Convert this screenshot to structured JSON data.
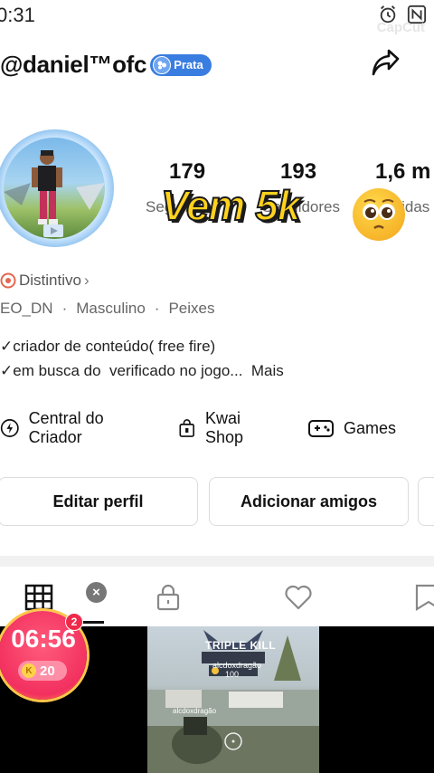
{
  "status_bar": {
    "time": "0:31",
    "watermark": "CapCut"
  },
  "profile": {
    "username": "@daniel™ofc",
    "badge_label": "Prata",
    "stats": [
      {
        "value": "179",
        "label": "Seguindo"
      },
      {
        "value": "193",
        "label": "Seguidores"
      },
      {
        "value": "1,6 m",
        "label": "Curtidas"
      }
    ],
    "promo_text": "Vem 5k",
    "distintivo_label": "Distintivo",
    "meta": [
      "EO_DN",
      "Masculino",
      "Peixes"
    ],
    "bio_lines": [
      "✓criador de conteúdo( free fire)",
      "✓em busca do  verificado no jogo...  Mais"
    ]
  },
  "quick_links": [
    {
      "icon": "lightning-icon",
      "label": "Central do Criador"
    },
    {
      "icon": "shopping-bag-icon",
      "label": "Kwai Shop"
    },
    {
      "icon": "gamepad-icon",
      "label": "Games"
    }
  ],
  "buttons": {
    "edit_profile": "Editar perfil",
    "add_friends": "Adicionar amigos"
  },
  "tabs": [
    {
      "icon": "grid-icon",
      "active": true
    },
    {
      "icon": "lock-icon",
      "active": false
    },
    {
      "icon": "heart-icon",
      "active": false
    },
    {
      "icon": "bookmark-icon",
      "active": false
    }
  ],
  "timer": {
    "time": "06:56",
    "badge_count": "2",
    "coins": "20",
    "coin_symbol": "K"
  },
  "video_overlay": {
    "kill_text": "TRIPLE KILL",
    "player_name": "alcdoxdragão",
    "score": "100",
    "feed_name": "alcdoxdragão"
  },
  "colors": {
    "accent_badge": "#3a7de0",
    "promo_yellow": "#ffd21e",
    "timer_pink": "#f2305f"
  }
}
